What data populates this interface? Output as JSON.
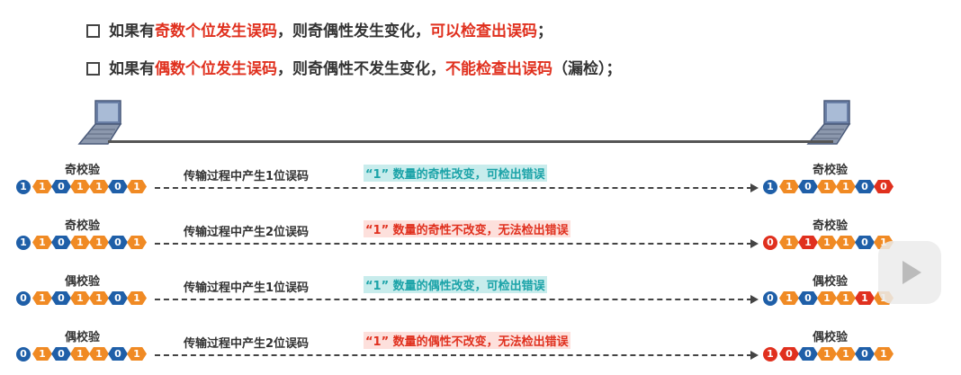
{
  "bullets": [
    {
      "pre": "如果有",
      "red1": "奇数个位发生误码",
      "mid": "，则奇偶性发生变化，",
      "red2": "可以检查出误码",
      "post": "；"
    },
    {
      "pre": "如果有",
      "red1": "偶数个位发生误码",
      "mid": "，则奇偶性不发生变化，",
      "red2": "不能检查出误码",
      "post": "（漏检）；",
      "red3": "漏检"
    }
  ],
  "rows": [
    {
      "left_label": "奇校验",
      "right_label": "奇校验",
      "desc": "传输过程中产生1位误码",
      "highlight": "“1” 数量的奇性改变，可检出错误",
      "highlight_color": "teal",
      "sent": [
        "1",
        "1",
        "0",
        "1",
        "1",
        "0",
        "1"
      ],
      "sent_colors": [
        "blue",
        "orange",
        "blue",
        "orange",
        "orange",
        "blue",
        "orange"
      ],
      "recv": [
        "1",
        "1",
        "0",
        "1",
        "1",
        "0",
        "0"
      ],
      "recv_colors": [
        "blue",
        "orange",
        "blue",
        "orange",
        "orange",
        "blue",
        "red"
      ]
    },
    {
      "left_label": "奇校验",
      "right_label": "奇校验",
      "desc": "传输过程中产生2位误码",
      "highlight": "“1” 数量的奇性不改变，无法检出错误",
      "highlight_color": "red",
      "sent": [
        "1",
        "1",
        "0",
        "1",
        "1",
        "0",
        "1"
      ],
      "sent_colors": [
        "blue",
        "orange",
        "blue",
        "orange",
        "orange",
        "blue",
        "orange"
      ],
      "recv": [
        "0",
        "1",
        "1",
        "1",
        "1",
        "0",
        "1"
      ],
      "recv_colors": [
        "red",
        "orange",
        "red",
        "orange",
        "orange",
        "blue",
        "orange"
      ]
    },
    {
      "left_label": "偶校验",
      "right_label": "偶校验",
      "desc": "传输过程中产生1位误码",
      "highlight": "“1” 数量的偶性改变，可检出错误",
      "highlight_color": "teal",
      "sent": [
        "0",
        "1",
        "0",
        "1",
        "1",
        "0",
        "1"
      ],
      "sent_colors": [
        "blue",
        "orange",
        "blue",
        "orange",
        "orange",
        "blue",
        "orange"
      ],
      "recv": [
        "0",
        "1",
        "0",
        "1",
        "1",
        "1",
        "1"
      ],
      "recv_colors": [
        "blue",
        "orange",
        "blue",
        "orange",
        "orange",
        "red",
        "orange"
      ]
    },
    {
      "left_label": "偶校验",
      "right_label": "偶校验",
      "desc": "传输过程中产生2位误码",
      "highlight": "“1” 数量的偶性不改变，无法检出错误",
      "highlight_color": "red",
      "sent": [
        "0",
        "1",
        "0",
        "1",
        "1",
        "0",
        "1"
      ],
      "sent_colors": [
        "blue",
        "orange",
        "blue",
        "orange",
        "orange",
        "blue",
        "orange"
      ],
      "recv": [
        "1",
        "0",
        "0",
        "1",
        "1",
        "0",
        "1"
      ],
      "recv_colors": [
        "red",
        "red",
        "blue",
        "orange",
        "orange",
        "blue",
        "orange"
      ]
    }
  ],
  "colors": {
    "blue": "#1f5fa8",
    "orange": "#f08a24",
    "red": "#e0301e",
    "teal": "#1ba3a8"
  }
}
